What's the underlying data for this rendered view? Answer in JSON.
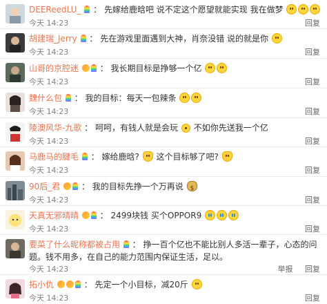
{
  "comments": [
    {
      "username": "DEEReedLU_",
      "badges": [
        "rainbow"
      ],
      "text": "先嫁给鹿晗吧 说不定这个愿望就能实现 我在做梦",
      "emojis": [
        "face",
        "face",
        "face"
      ],
      "time": "今天 14:23",
      "actions": [
        "回复"
      ]
    },
    {
      "username": "胡建瑞_Jerry",
      "badges": [
        "rainbow"
      ],
      "text": "先在游戏里面遇到大神，肖奈没错 说的就是你",
      "emojis": [
        "face"
      ],
      "time": "今天 14:23",
      "actions": [
        "回复"
      ]
    },
    {
      "username": "山哥的京腔迷",
      "badges": [
        "vip",
        "rainbow"
      ],
      "text": "我长期目标是挣够一个亿",
      "emojis": [
        "face",
        "face"
      ],
      "time": "今天 14:23",
      "actions": [
        "回复"
      ]
    },
    {
      "username": "魏什么包",
      "badges": [
        "rainbow"
      ],
      "text": "我的目标：每天一包辣条",
      "emojis": [
        "face",
        "face"
      ],
      "time": "今天 14:23",
      "actions": [
        "回复"
      ]
    },
    {
      "username": "陵澳风华-九歌",
      "badges": [],
      "text": "呵呵，有钱人就是会玩",
      "text2": "不如你先送我一个亿",
      "emojis": [
        "face"
      ],
      "time": "今天 14:23",
      "actions": [
        "回复"
      ]
    },
    {
      "username": "马鹿马的腱毛",
      "badges": [
        "rainbow"
      ],
      "text": "嫁给鹿晗?",
      "text2": "这个目标够了吧?",
      "emojis": [
        "cat",
        "cat"
      ],
      "time": "今天 14:23",
      "actions": [
        "回复"
      ]
    },
    {
      "username": "90后_君",
      "badges": [
        "vip",
        "rainbow"
      ],
      "text": "我的目标先挣一个万再说",
      "emojis": [
        "sack"
      ],
      "time": "今天 14:23",
      "actions": [
        "回复"
      ]
    },
    {
      "username": "天真无邪晴晴",
      "badges": [
        "vip",
        "rainbow"
      ],
      "text": "2499块钱 买个OPPOR9",
      "emojis": [
        "cry",
        "cry",
        "cry"
      ],
      "time": "今天 14:23",
      "actions": [
        "回复"
      ]
    },
    {
      "username": "要菜了什么昵称都被占用",
      "badges": [
        "rainbow"
      ],
      "text": "挣一百个亿也不能比别人多活一辈子，心态的问题。钱不用多，在自己的能力范围内保证生活，足以。",
      "emojis": [],
      "time": "今天 14:23",
      "actions": [
        "举报",
        "回复"
      ]
    },
    {
      "username": "拓小仇",
      "badges": [
        "vip",
        "vip",
        "rainbow"
      ],
      "text": "先定一个小目标，减20斤",
      "emojis": [
        "face"
      ],
      "time": "今天 14:23",
      "actions": [
        "回复"
      ]
    }
  ]
}
